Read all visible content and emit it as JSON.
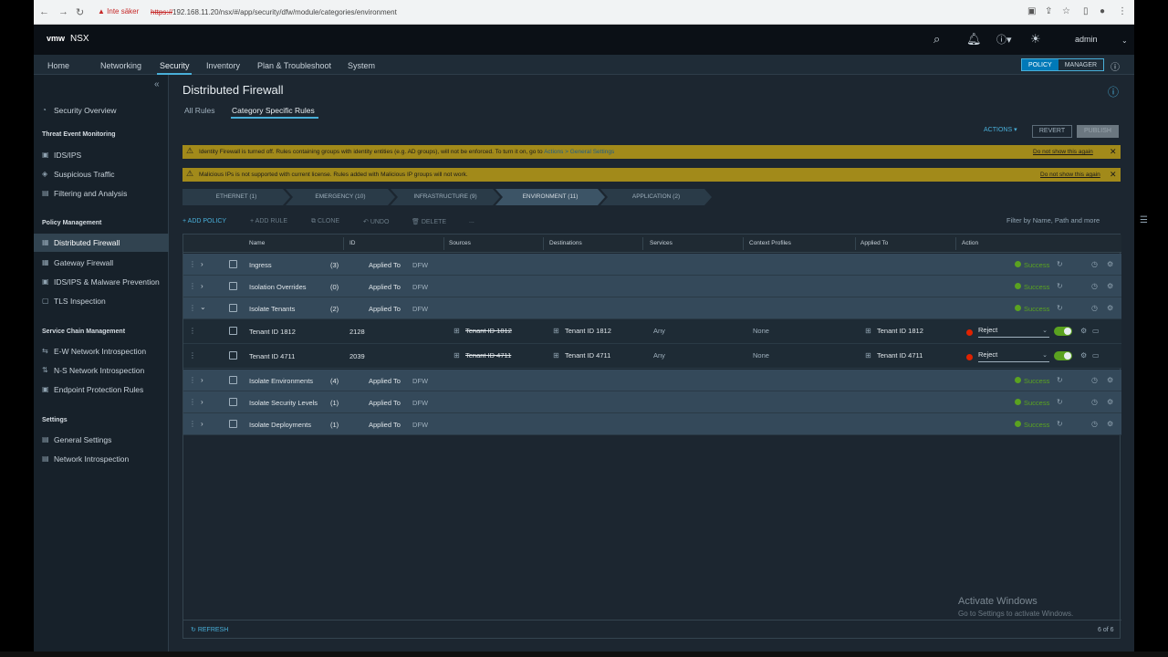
{
  "browser": {
    "security_warning": "Inte säker",
    "url_scheme": "https://",
    "url_rest": "192.168.11.20/nsx/#/app/security/dfw/module/categories/environment"
  },
  "header": {
    "brand": "vmw",
    "product": "NSX",
    "user": "admin"
  },
  "nav": {
    "items": [
      "Home",
      "Networking",
      "Security",
      "Inventory",
      "Plan & Troubleshoot",
      "System"
    ],
    "active": "Security",
    "mode_policy": "POLICY",
    "mode_manager": "MANAGER"
  },
  "sidebar": {
    "security_overview": "Security Overview",
    "threat_header": "Threat Event Monitoring",
    "ids_ips": "IDS/IPS",
    "suspicious": "Suspicious Traffic",
    "filtering": "Filtering and Analysis",
    "policy_header": "Policy Management",
    "dfw": "Distributed Firewall",
    "gateway": "Gateway Firewall",
    "ids_malware": "IDS/IPS & Malware Prevention",
    "tls": "TLS Inspection",
    "chain_header": "Service Chain Management",
    "ew": "E-W Network Introspection",
    "ns": "N-S Network Introspection",
    "endpoint": "Endpoint Protection Rules",
    "settings_header": "Settings",
    "general": "General Settings",
    "netintro": "Network Introspection"
  },
  "page": {
    "title": "Distributed Firewall",
    "tab_all": "All Rules",
    "tab_category": "Category Specific Rules",
    "actions": "ACTIONS",
    "revert": "REVERT",
    "publish": "PUBLISH"
  },
  "alerts": {
    "idfw_msg": "Identity Firewall is turned off. Rules containing groups with identity entities (e.g. AD groups), will not be enforced. To turn it on, go to",
    "idfw_link": "Actions > General Settings",
    "malicious_msg": "Malicious IPs is not supported with current license. Rules added with Malicious IP groups will not work.",
    "dismiss": "Do not show this again"
  },
  "categories": [
    "ETHERNET (1)",
    "EMERGENCY (10)",
    "INFRASTRUCTURE (9)",
    "ENVIRONMENT (11)",
    "APPLICATION (2)"
  ],
  "toolbar": {
    "add_policy": "ADD POLICY",
    "add_rule": "ADD RULE",
    "clone": "CLONE",
    "undo": "UNDO",
    "delete": "DELETE",
    "more": "...",
    "filter_placeholder": "Filter by Name, Path and more"
  },
  "table": {
    "columns": [
      "Name",
      "ID",
      "Sources",
      "Destinations",
      "Services",
      "Context Profiles",
      "Applied To",
      "Action"
    ],
    "applied_to_label": "Applied To",
    "dfw": "DFW",
    "status": "Success",
    "policies": [
      {
        "name": "Ingress",
        "count": "(3)"
      },
      {
        "name": "Isolation Overrides",
        "count": "(0)"
      },
      {
        "name": "Isolate Tenants",
        "count": "(2)"
      },
      {
        "name": "Isolate Environments",
        "count": "(4)"
      },
      {
        "name": "Isolate Security Levels",
        "count": "(1)"
      },
      {
        "name": "Isolate Deployments",
        "count": "(1)"
      }
    ],
    "rules": [
      {
        "name": "Tenant ID 1812",
        "id": "2128",
        "source": "Tenant ID 1812",
        "destination": "Tenant ID 1812",
        "service": "Any",
        "profile": "None",
        "applied": "Tenant ID 1812",
        "action": "Reject"
      },
      {
        "name": "Tenant ID 4711",
        "id": "2039",
        "source": "Tenant ID 4711",
        "destination": "Tenant ID 4711",
        "service": "Any",
        "profile": "None",
        "applied": "Tenant ID 4711",
        "action": "Reject"
      }
    ],
    "refresh": "REFRESH",
    "count": "6 of 6"
  },
  "watermark": {
    "line1": "Activate Windows",
    "line2": "Go to Settings to activate Windows."
  },
  "colors": {
    "accent": "#49afd9",
    "success": "#5aa220",
    "reject": "#e02200",
    "warning": "#a28a1a"
  }
}
